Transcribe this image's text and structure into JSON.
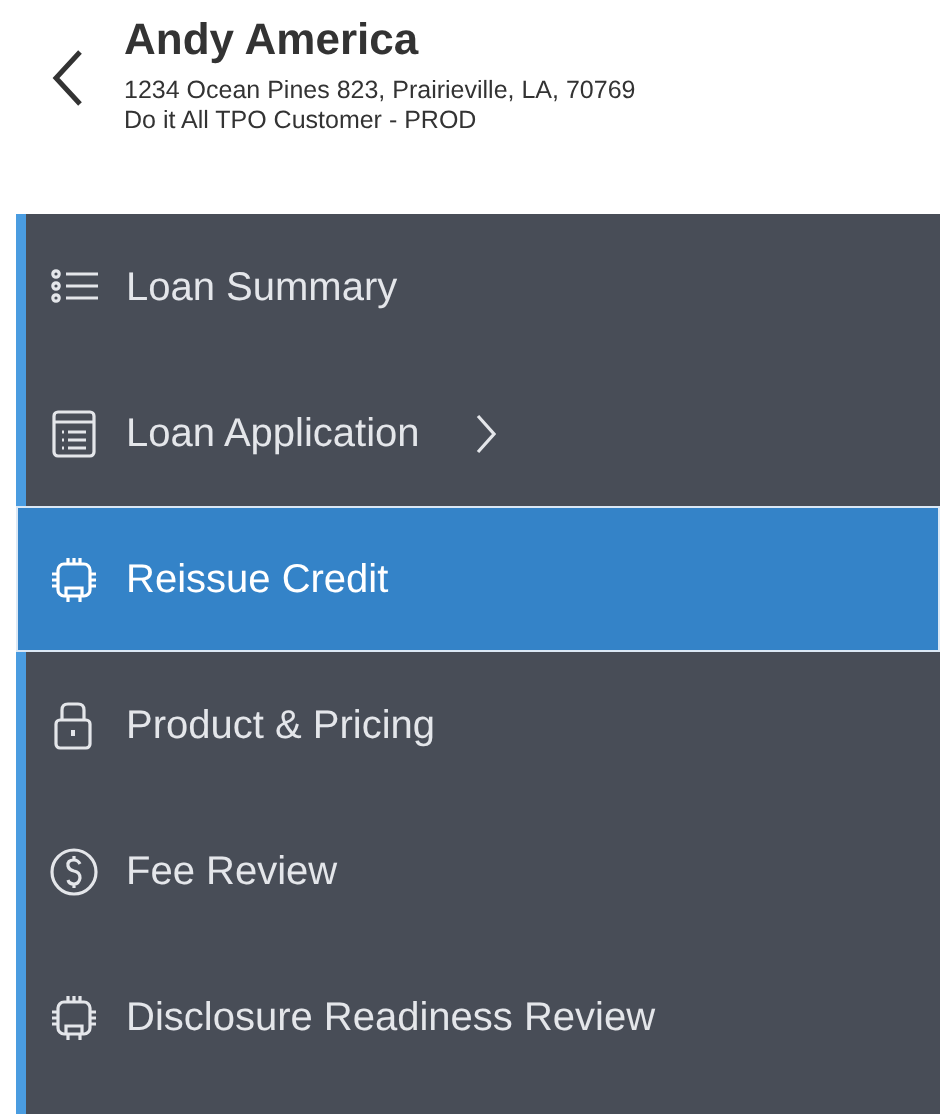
{
  "header": {
    "name": "Andy America",
    "address": "1234 Ocean Pines 823, Prairieville, LA, 70769",
    "customer": "Do it All TPO Customer - PROD"
  },
  "nav": [
    {
      "label": "Loan Summary",
      "kind": "list",
      "selected": false,
      "expandable": false
    },
    {
      "label": "Loan Application",
      "kind": "form",
      "selected": false,
      "expandable": true
    },
    {
      "label": "Reissue Credit",
      "kind": "chip",
      "selected": true,
      "expandable": false
    },
    {
      "label": "Product & Pricing",
      "kind": "lock",
      "selected": false,
      "expandable": false
    },
    {
      "label": "Fee Review",
      "kind": "dollar",
      "selected": false,
      "expandable": false
    },
    {
      "label": "Disclosure Readiness Review",
      "kind": "chip",
      "selected": false,
      "expandable": false
    }
  ]
}
